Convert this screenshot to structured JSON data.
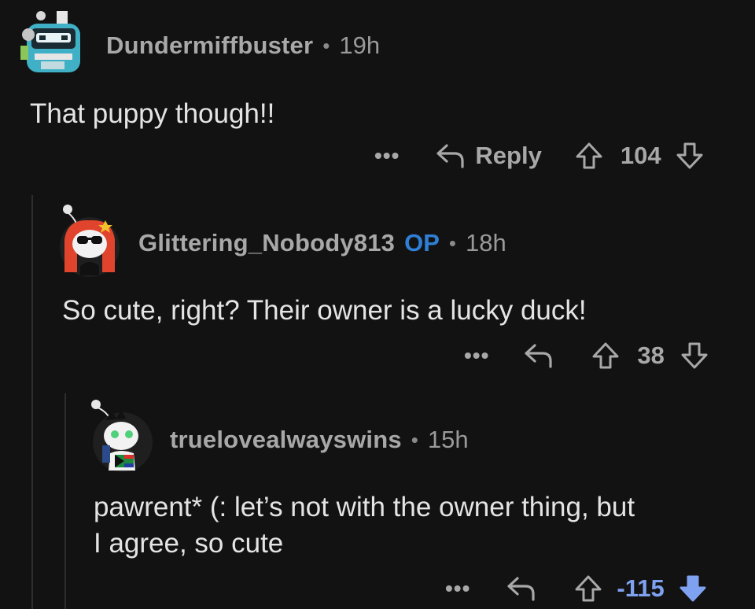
{
  "comments": [
    {
      "username": "Dundermiffbuster",
      "op_badge": "",
      "separator": "•",
      "time": "19h",
      "text": "That puppy though!!",
      "more": "•••",
      "reply_label": "Reply",
      "score": "104",
      "vote_state": "none"
    },
    {
      "username": "Glittering_Nobody813",
      "op_badge": "OP",
      "separator": "•",
      "time": "18h",
      "text": "So cute, right? Their owner is a lucky duck!",
      "more": "•••",
      "reply_label": "",
      "score": "38",
      "vote_state": "none"
    },
    {
      "username": "truelovealwayswins",
      "op_badge": "",
      "separator": "•",
      "time": "15h",
      "text_line1": "pawrent* (: let’s not with the owner thing, but",
      "text_line2": "I agree, so cute",
      "more": "•••",
      "reply_label": "",
      "score": "-115",
      "vote_state": "downvoted"
    }
  ],
  "colors": {
    "background": "#121212",
    "op": "#2f7fd6",
    "downvote": "#7fa2f0"
  }
}
